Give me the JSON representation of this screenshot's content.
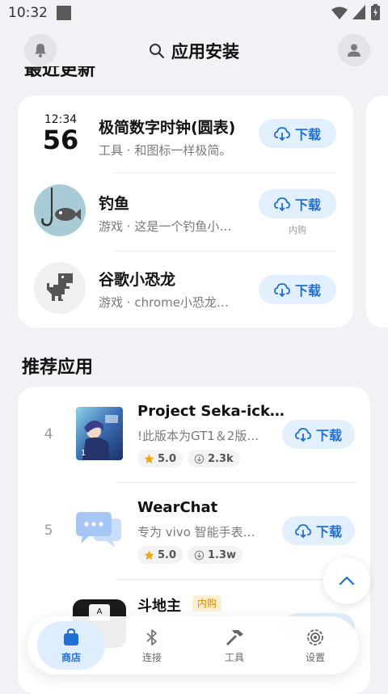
{
  "status": {
    "time": "10:32"
  },
  "header": {
    "title": "应用安装"
  },
  "recent": {
    "title_partial": "最近更新",
    "items": [
      {
        "name": "极简数字时钟(圆表)",
        "category": "工具",
        "desc": "和图标一样极简。",
        "button": "下载",
        "clock_time": "12:34",
        "clock_big": "56"
      },
      {
        "name": "钓鱼",
        "category": "游戏",
        "desc": "这是一个钓鱼小…",
        "button": "下载",
        "note": "内购"
      },
      {
        "name": "谷歌小恐龙",
        "category": "游戏",
        "desc": "chrome小恐龙…",
        "button": "下载"
      }
    ]
  },
  "recommended": {
    "title": "推荐应用",
    "items": [
      {
        "rank": "4",
        "name": "Project  Seka-ick…",
        "desc": "!此版本为GT1＆2版…",
        "rating": "5.0",
        "downloads": "2.3k",
        "button": "下载"
      },
      {
        "rank": "5",
        "name": "WearChat",
        "desc": "专为 vivo 智能手表…",
        "rating": "5.0",
        "downloads": "1.3w",
        "button": "下载"
      },
      {
        "rank": "",
        "name": "斗地主",
        "tag": "内购"
      }
    ]
  },
  "nav": {
    "items": [
      {
        "label": "商店",
        "icon": "bag-icon"
      },
      {
        "label": "连接",
        "icon": "bluetooth-icon"
      },
      {
        "label": "工具",
        "icon": "hammer-icon"
      },
      {
        "label": "设置",
        "icon": "settings-icon"
      }
    ]
  },
  "colors": {
    "accent": "#1f6fd6",
    "accent_bg": "#e2effc",
    "star": "#f0a800",
    "background": "#f2f2f6"
  }
}
